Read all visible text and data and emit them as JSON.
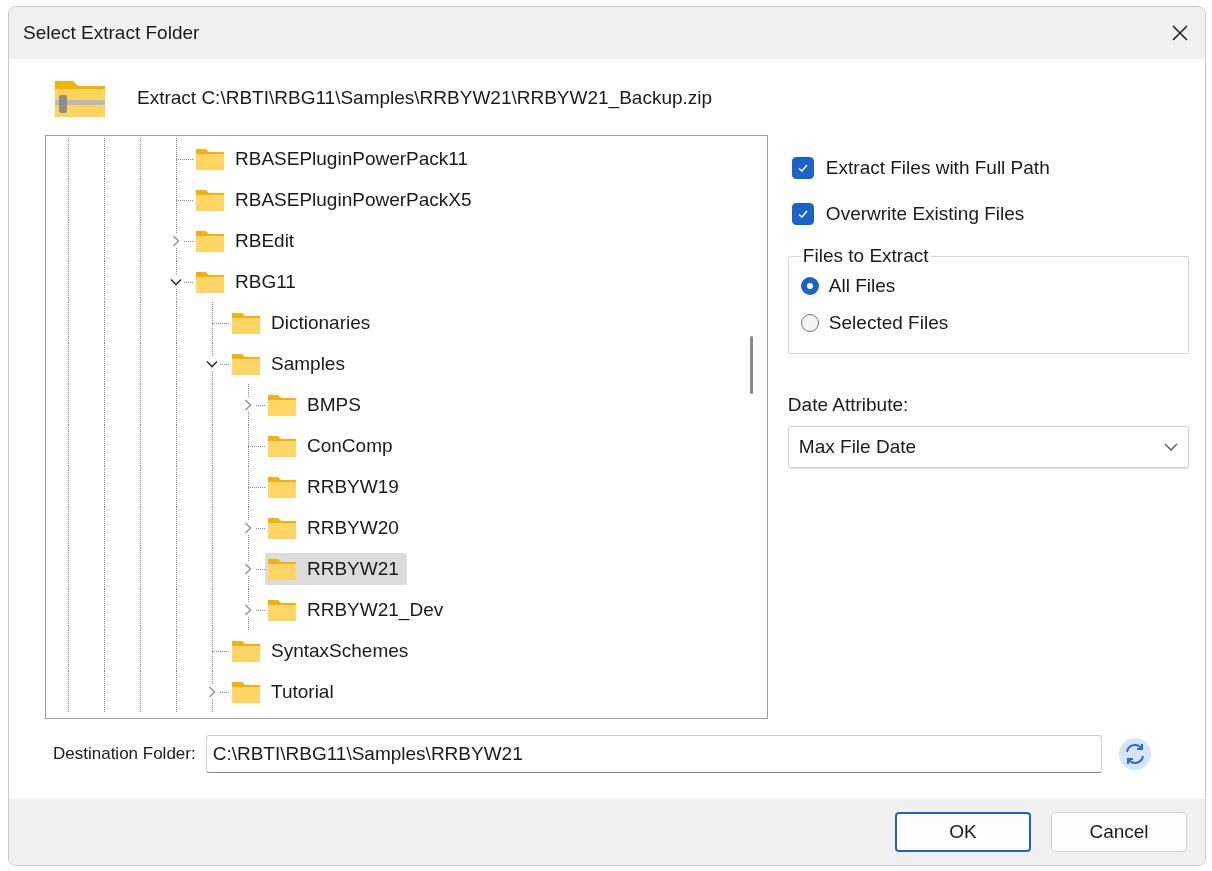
{
  "window": {
    "title": "Select Extract Folder"
  },
  "archive_label": "Extract C:\\RBTI\\RBG11\\Samples\\RRBYW21\\RRBYW21_Backup.zip",
  "tree": [
    {
      "label": "RBASEPluginPowerPack11",
      "selected": false
    },
    {
      "label": "RBASEPluginPowerPackX5",
      "selected": false
    },
    {
      "label": "RBEdit",
      "expanded": false,
      "selected": false
    },
    {
      "label": "RBG11",
      "expanded": true,
      "selected": false,
      "children": [
        {
          "label": "Dictionaries",
          "selected": false
        },
        {
          "label": "Samples",
          "expanded": true,
          "selected": false,
          "children": [
            {
              "label": "BMPS",
              "expanded": false,
              "selected": false
            },
            {
              "label": "ConComp",
              "selected": false
            },
            {
              "label": "RRBYW19",
              "selected": false
            },
            {
              "label": "RRBYW20",
              "expanded": false,
              "selected": false
            },
            {
              "label": "RRBYW21",
              "expanded": false,
              "selected": true
            },
            {
              "label": "RRBYW21_Dev",
              "expanded": false,
              "selected": false
            }
          ]
        },
        {
          "label": "SyntaxSchemes",
          "selected": false
        },
        {
          "label": "Tutorial",
          "expanded": false,
          "selected": false
        }
      ]
    }
  ],
  "options": [
    {
      "label": "Extract Files with Full Path",
      "checked": true
    },
    {
      "label": "Overwrite Existing Files",
      "checked": true
    }
  ],
  "files_to_extract": {
    "title": "Files to Extract",
    "options": [
      {
        "label": "All Files",
        "selected": true
      },
      {
        "label": "Selected Files",
        "selected": false
      }
    ]
  },
  "date_attribute": {
    "label": "Date Attribute:",
    "value": "Max File Date"
  },
  "destination": {
    "label": "Destination Folder:",
    "value": "C:\\RBTI\\RBG11\\Samples\\RRBYW21"
  },
  "buttons": [
    {
      "label": "OK",
      "default": true
    },
    {
      "label": "Cancel",
      "default": false
    }
  ]
}
